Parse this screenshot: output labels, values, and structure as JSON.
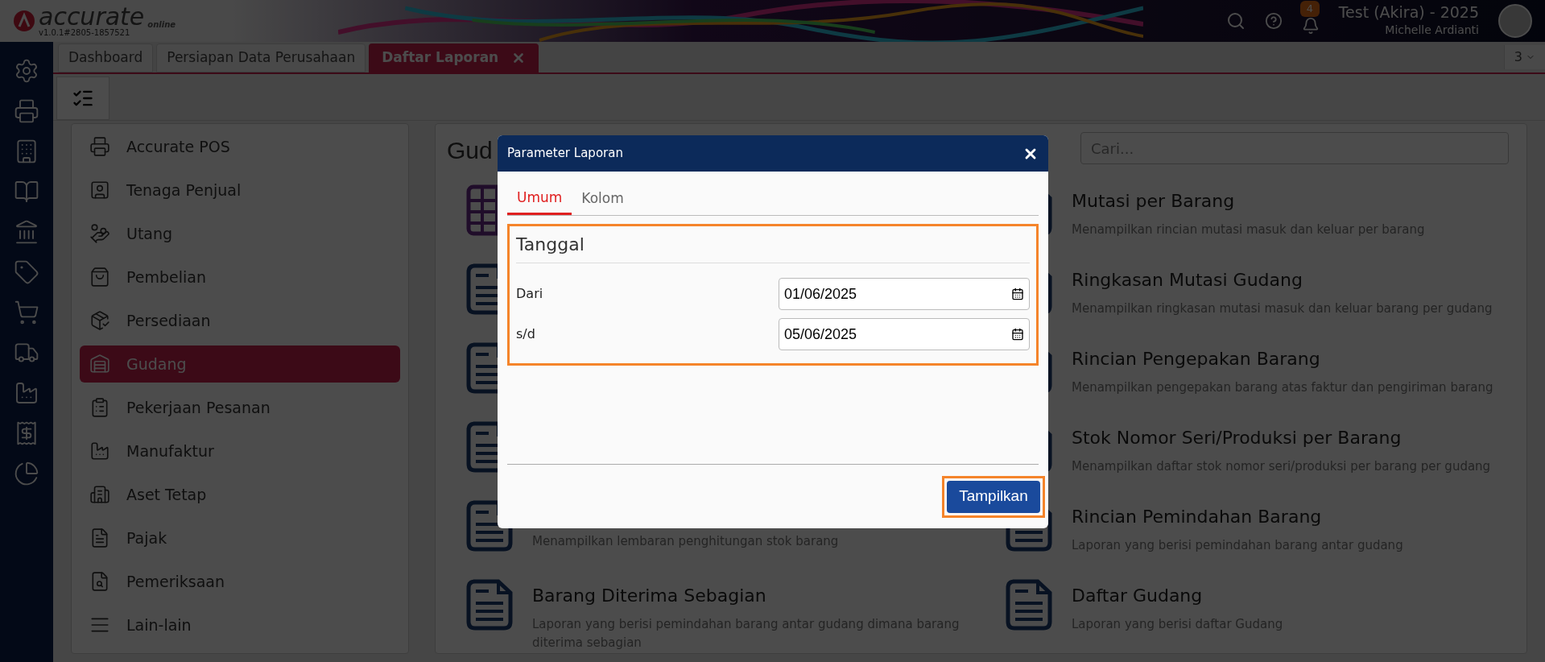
{
  "header": {
    "logo_text": "accurate",
    "logo_sub": "online",
    "version": "v1.0.1#2805-1857521",
    "notification_count": "4",
    "company": "Test (Akira) - 2025",
    "user": "Michelle Ardianti"
  },
  "tabs": [
    {
      "label": "Dashboard",
      "selected": false,
      "closable": false
    },
    {
      "label": "Persiapan Data Perusahaan",
      "selected": false,
      "closable": false
    },
    {
      "label": "Daftar Laporan",
      "selected": true,
      "closable": true
    }
  ],
  "tab_overflow": "3",
  "menu": {
    "items": [
      {
        "label": "Accurate POS",
        "selected": false
      },
      {
        "label": "Tenaga Penjual",
        "selected": false
      },
      {
        "label": "Utang",
        "selected": false
      },
      {
        "label": "Pembelian",
        "selected": false
      },
      {
        "label": "Persediaan",
        "selected": false
      },
      {
        "label": "Gudang",
        "selected": true
      },
      {
        "label": "Pekerjaan Pesanan",
        "selected": false
      },
      {
        "label": "Manufaktur",
        "selected": false
      },
      {
        "label": "Aset Tetap",
        "selected": false
      },
      {
        "label": "Pajak",
        "selected": false
      },
      {
        "label": "Pemeriksaan",
        "selected": false
      },
      {
        "label": "Lain-lain",
        "selected": false
      }
    ]
  },
  "content": {
    "title": "Gud",
    "search": {
      "placeholder": "Cari..."
    },
    "left_reports": [
      {
        "kind": "grid"
      },
      {
        "kind": "document"
      },
      {
        "kind": "document"
      },
      {
        "kind": "document"
      },
      {
        "kind": "document",
        "description": "Menampilkan lembaran penghitungan stok barang"
      },
      {
        "kind": "document",
        "title": "Barang Diterima Sebagian",
        "description": "Laporan yang berisi pemindahan barang antar gudang dimana barang diterima sebagian"
      }
    ],
    "right_reports": [
      {
        "kind": "document",
        "title": "Mutasi per Barang",
        "description": "Menampilkan rincian mutasi masuk dan keluar per barang"
      },
      {
        "kind": "document",
        "title": "Ringkasan Mutasi Gudang",
        "description": "Menampilkan ringkasan mutasi masuk dan keluar barang per gudang"
      },
      {
        "kind": "document",
        "title": "Rincian Pengepakan Barang",
        "description": "Menampilkan pengepakan barang atas faktur dan pengiriman barang"
      },
      {
        "kind": "document",
        "title": "Stok Nomor Seri/Produksi per Barang",
        "description": "Menampilkan daftar stok nomor seri/produksi per barang per gudang"
      },
      {
        "kind": "document",
        "title": "Rincian Pemindahan Barang",
        "description": "Laporan yang berisi pemindahan barang antar gudang"
      },
      {
        "kind": "document",
        "title": "Daftar Gudang",
        "description": "Laporan yang berisi daftar Gudang"
      }
    ]
  },
  "dialog": {
    "title": "Parameter Laporan",
    "tabs": [
      {
        "label": "Umum",
        "selected": true
      },
      {
        "label": "Kolom",
        "selected": false
      }
    ],
    "section": {
      "title": "Tanggal",
      "highlighted": true,
      "fields": [
        {
          "label": "Dari",
          "value": "01/06/2025"
        },
        {
          "label": "s/d",
          "value": "05/06/2025"
        }
      ]
    },
    "button": {
      "label": "Tampilkan",
      "highlighted": true
    }
  }
}
